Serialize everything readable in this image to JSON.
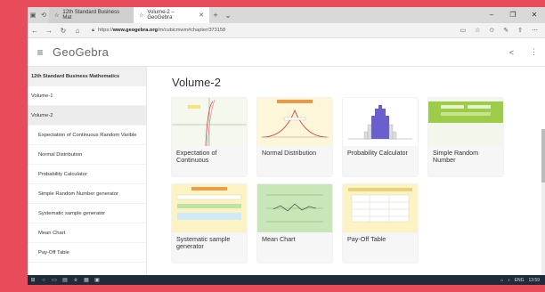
{
  "browser": {
    "tabs": [
      {
        "label": "12th Standard Business Mat"
      },
      {
        "label": "Volume-2 – GeoGebra"
      }
    ],
    "url_prefix": "https://",
    "url_domain": "www.geogebra.org",
    "url_path": "/m/cubicmwm#chapter/373158",
    "win_controls": [
      "–",
      "❐",
      "✕"
    ],
    "tray": [
      "ENG",
      "13:59"
    ]
  },
  "app": {
    "logo": "GeoGebra"
  },
  "sidebar": {
    "title": "12th Standard Business Mathematics",
    "items": [
      {
        "label": "Volume-1"
      },
      {
        "label": "Volume-2"
      }
    ],
    "subitems": [
      {
        "label": "Expectation of Continuous Random Varible"
      },
      {
        "label": "Normal Distribution"
      },
      {
        "label": "Probability Calculator"
      },
      {
        "label": "Simple Random Number generator"
      },
      {
        "label": "Systematic sample generator"
      },
      {
        "label": "Mean Chart"
      },
      {
        "label": "Pay-Off Table"
      }
    ]
  },
  "main": {
    "title": "Volume-2",
    "cards": [
      {
        "label": "Expectation of Continuous"
      },
      {
        "label": "Normal Distribution"
      },
      {
        "label": "Probability Calculator"
      },
      {
        "label": "Simple Random Number"
      },
      {
        "label": "Systematic sample generator"
      },
      {
        "label": "Mean Chart"
      },
      {
        "label": "Pay-Off Table"
      }
    ]
  },
  "colors": {
    "background": "#e84b5a",
    "taskbar": "#1f2a3a",
    "accent": "#6b5fd0"
  }
}
